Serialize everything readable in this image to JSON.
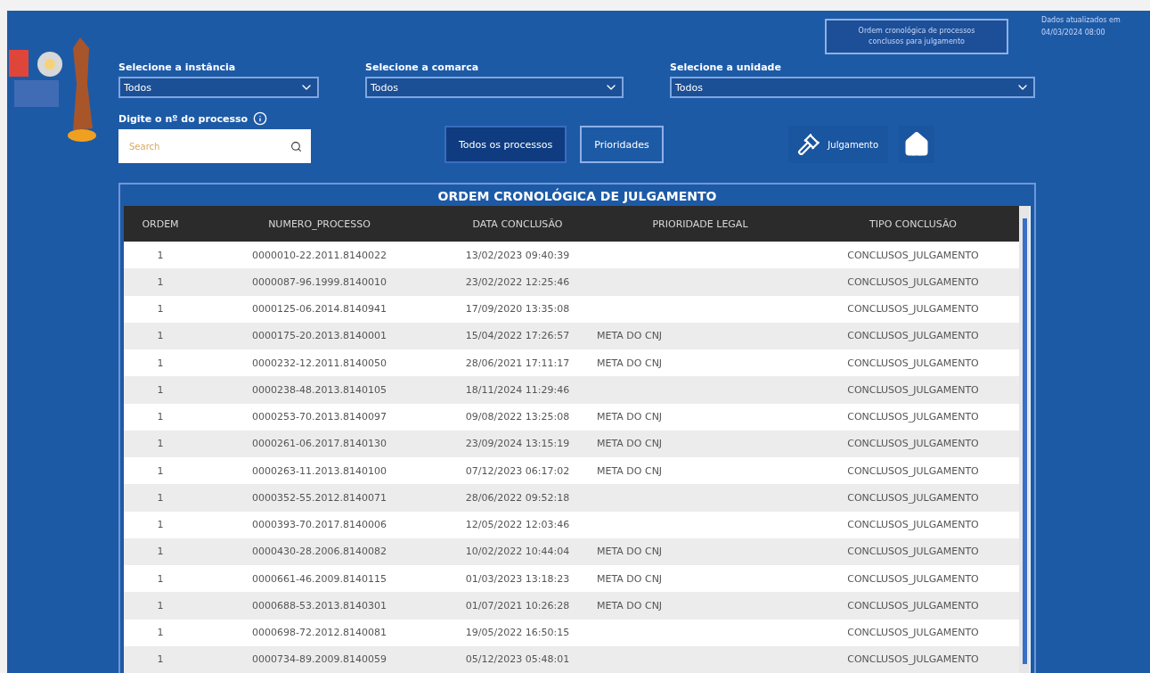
{
  "header": {
    "update_info": [
      "Dados atualizados em",
      "04/03/2024 08:00"
    ],
    "top_button": [
      "Ordem cronológica de processos",
      "conclusos para julgamento"
    ]
  },
  "filters": [
    {
      "label": "Selecione a instância",
      "value": "Todos"
    },
    {
      "label": "Selecione a comarca",
      "value": "Todos"
    },
    {
      "label": "Selecione a unidade",
      "value": "Todos"
    }
  ],
  "search": {
    "label": "Digite o nº do processo",
    "placeholder": "Search"
  },
  "buttons": [
    {
      "label": "Todos os processos",
      "selected": true
    },
    {
      "label": "Prioridades",
      "selected": false
    }
  ],
  "judgment_button": {
    "label": "Julgamento"
  },
  "table": {
    "title": "ORDEM CRONOLÓGICA DE JULGAMENTO",
    "columns": [
      "ORDEM",
      "NUMERO_PROCESSO",
      "DATA CONCLUSÃO",
      "PRIORIDADE LEGAL",
      "TIPO CONCLUSÃO"
    ],
    "rows": [
      [
        "1",
        "0000010-22.2011.8140022",
        "13/02/2023 09:40:39",
        "",
        "CONCLUSOS_JULGAMENTO"
      ],
      [
        "1",
        "0000087-96.1999.8140010",
        "23/02/2022 12:25:46",
        "",
        "CONCLUSOS_JULGAMENTO"
      ],
      [
        "1",
        "0000125-06.2014.8140941",
        "17/09/2020 13:35:08",
        "",
        "CONCLUSOS_JULGAMENTO"
      ],
      [
        "1",
        "0000175-20.2013.8140001",
        "15/04/2022 17:26:57",
        "META DO CNJ",
        "CONCLUSOS_JULGAMENTO"
      ],
      [
        "1",
        "0000232-12.2011.8140050",
        "28/06/2021 17:11:17",
        "META DO CNJ",
        "CONCLUSOS_JULGAMENTO"
      ],
      [
        "1",
        "0000238-48.2013.8140105",
        "18/11/2024 11:29:46",
        "",
        "CONCLUSOS_JULGAMENTO"
      ],
      [
        "1",
        "0000253-70.2013.8140097",
        "09/08/2022 13:25:08",
        "META DO CNJ",
        "CONCLUSOS_JULGAMENTO"
      ],
      [
        "1",
        "0000261-06.2017.8140130",
        "23/09/2024 13:15:19",
        "META DO CNJ",
        "CONCLUSOS_JULGAMENTO"
      ],
      [
        "1",
        "0000263-11.2013.8140100",
        "07/12/2023 06:17:02",
        "META DO CNJ",
        "CONCLUSOS_JULGAMENTO"
      ],
      [
        "1",
        "0000352-55.2012.8140071",
        "28/06/2022 09:52:18",
        "",
        "CONCLUSOS_JULGAMENTO"
      ],
      [
        "1",
        "0000393-70.2017.8140006",
        "12/05/2022 12:03:46",
        "",
        "CONCLUSOS_JULGAMENTO"
      ],
      [
        "1",
        "0000430-28.2006.8140082",
        "10/02/2022 10:44:04",
        "META DO CNJ",
        "CONCLUSOS_JULGAMENTO"
      ],
      [
        "1",
        "0000661-46.2009.8140115",
        "01/03/2023 13:18:23",
        "META DO CNJ",
        "CONCLUSOS_JULGAMENTO"
      ],
      [
        "1",
        "0000688-53.2013.8140301",
        "01/07/2021 10:26:28",
        "META DO CNJ",
        "CONCLUSOS_JULGAMENTO"
      ],
      [
        "1",
        "0000698-72.2012.8140081",
        "19/05/2022 16:50:15",
        "",
        "CONCLUSOS_JULGAMENTO"
      ],
      [
        "1",
        "0000734-89.2009.8140059",
        "05/12/2023 05:48:01",
        "",
        "CONCLUSOS_JULGAMENTO"
      ]
    ]
  }
}
